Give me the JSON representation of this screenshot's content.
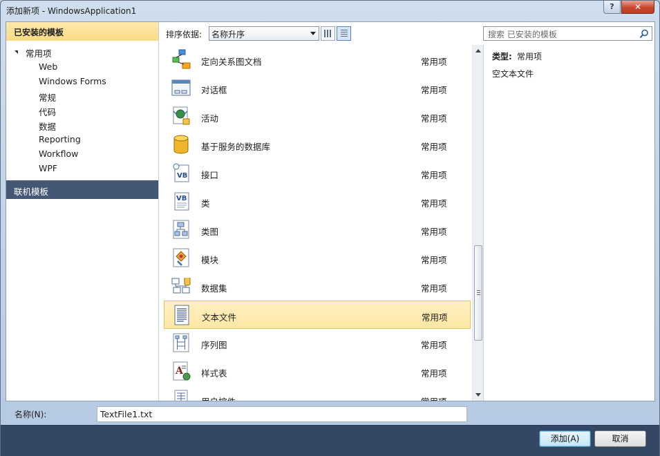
{
  "window": {
    "title": "添加新项 - WindowsApplication1",
    "help_label": "?",
    "close_label": "✕"
  },
  "left": {
    "installed_header": "已安装的模板",
    "root": "常用项",
    "children": [
      "Web",
      "Windows Forms",
      "常规",
      "代码",
      "数据",
      "Reporting",
      "Workflow",
      "WPF"
    ],
    "online_header": "联机模板"
  },
  "toolbar": {
    "sort_label": "排序依据:",
    "sort_value": "名称升序",
    "search_placeholder": "搜索 已安装的模板"
  },
  "items": [
    {
      "name": "定向关系图文档",
      "category": "常用项",
      "icon": "directed-graph-icon"
    },
    {
      "name": "对话框",
      "category": "常用项",
      "icon": "dialog-icon"
    },
    {
      "name": "活动",
      "category": "常用项",
      "icon": "activity-icon"
    },
    {
      "name": "基于服务的数据库",
      "category": "常用项",
      "icon": "database-icon"
    },
    {
      "name": "接口",
      "category": "常用项",
      "icon": "vb-interface-icon"
    },
    {
      "name": "类",
      "category": "常用项",
      "icon": "vb-class-icon"
    },
    {
      "name": "类图",
      "category": "常用项",
      "icon": "class-diagram-icon"
    },
    {
      "name": "模块",
      "category": "常用项",
      "icon": "module-icon"
    },
    {
      "name": "数据集",
      "category": "常用项",
      "icon": "dataset-icon"
    },
    {
      "name": "文本文件",
      "category": "常用项",
      "icon": "text-file-icon",
      "selected": true
    },
    {
      "name": "序列图",
      "category": "常用项",
      "icon": "sequence-diagram-icon"
    },
    {
      "name": "样式表",
      "category": "常用项",
      "icon": "stylesheet-icon"
    },
    {
      "name": "用户控件",
      "category": "常用项",
      "icon": "user-control-icon"
    }
  ],
  "details": {
    "type_label": "类型:",
    "type_value": "常用项",
    "description": "空文本文件"
  },
  "bottom": {
    "name_label": "名称(N):",
    "name_value": "TextFile1.txt",
    "add_label": "添加(A)",
    "cancel_label": "取消"
  },
  "colors": {
    "accent": "#445775",
    "selection": "#fde7a4",
    "installed_header": "#fbdb84",
    "footer": "#344866"
  }
}
